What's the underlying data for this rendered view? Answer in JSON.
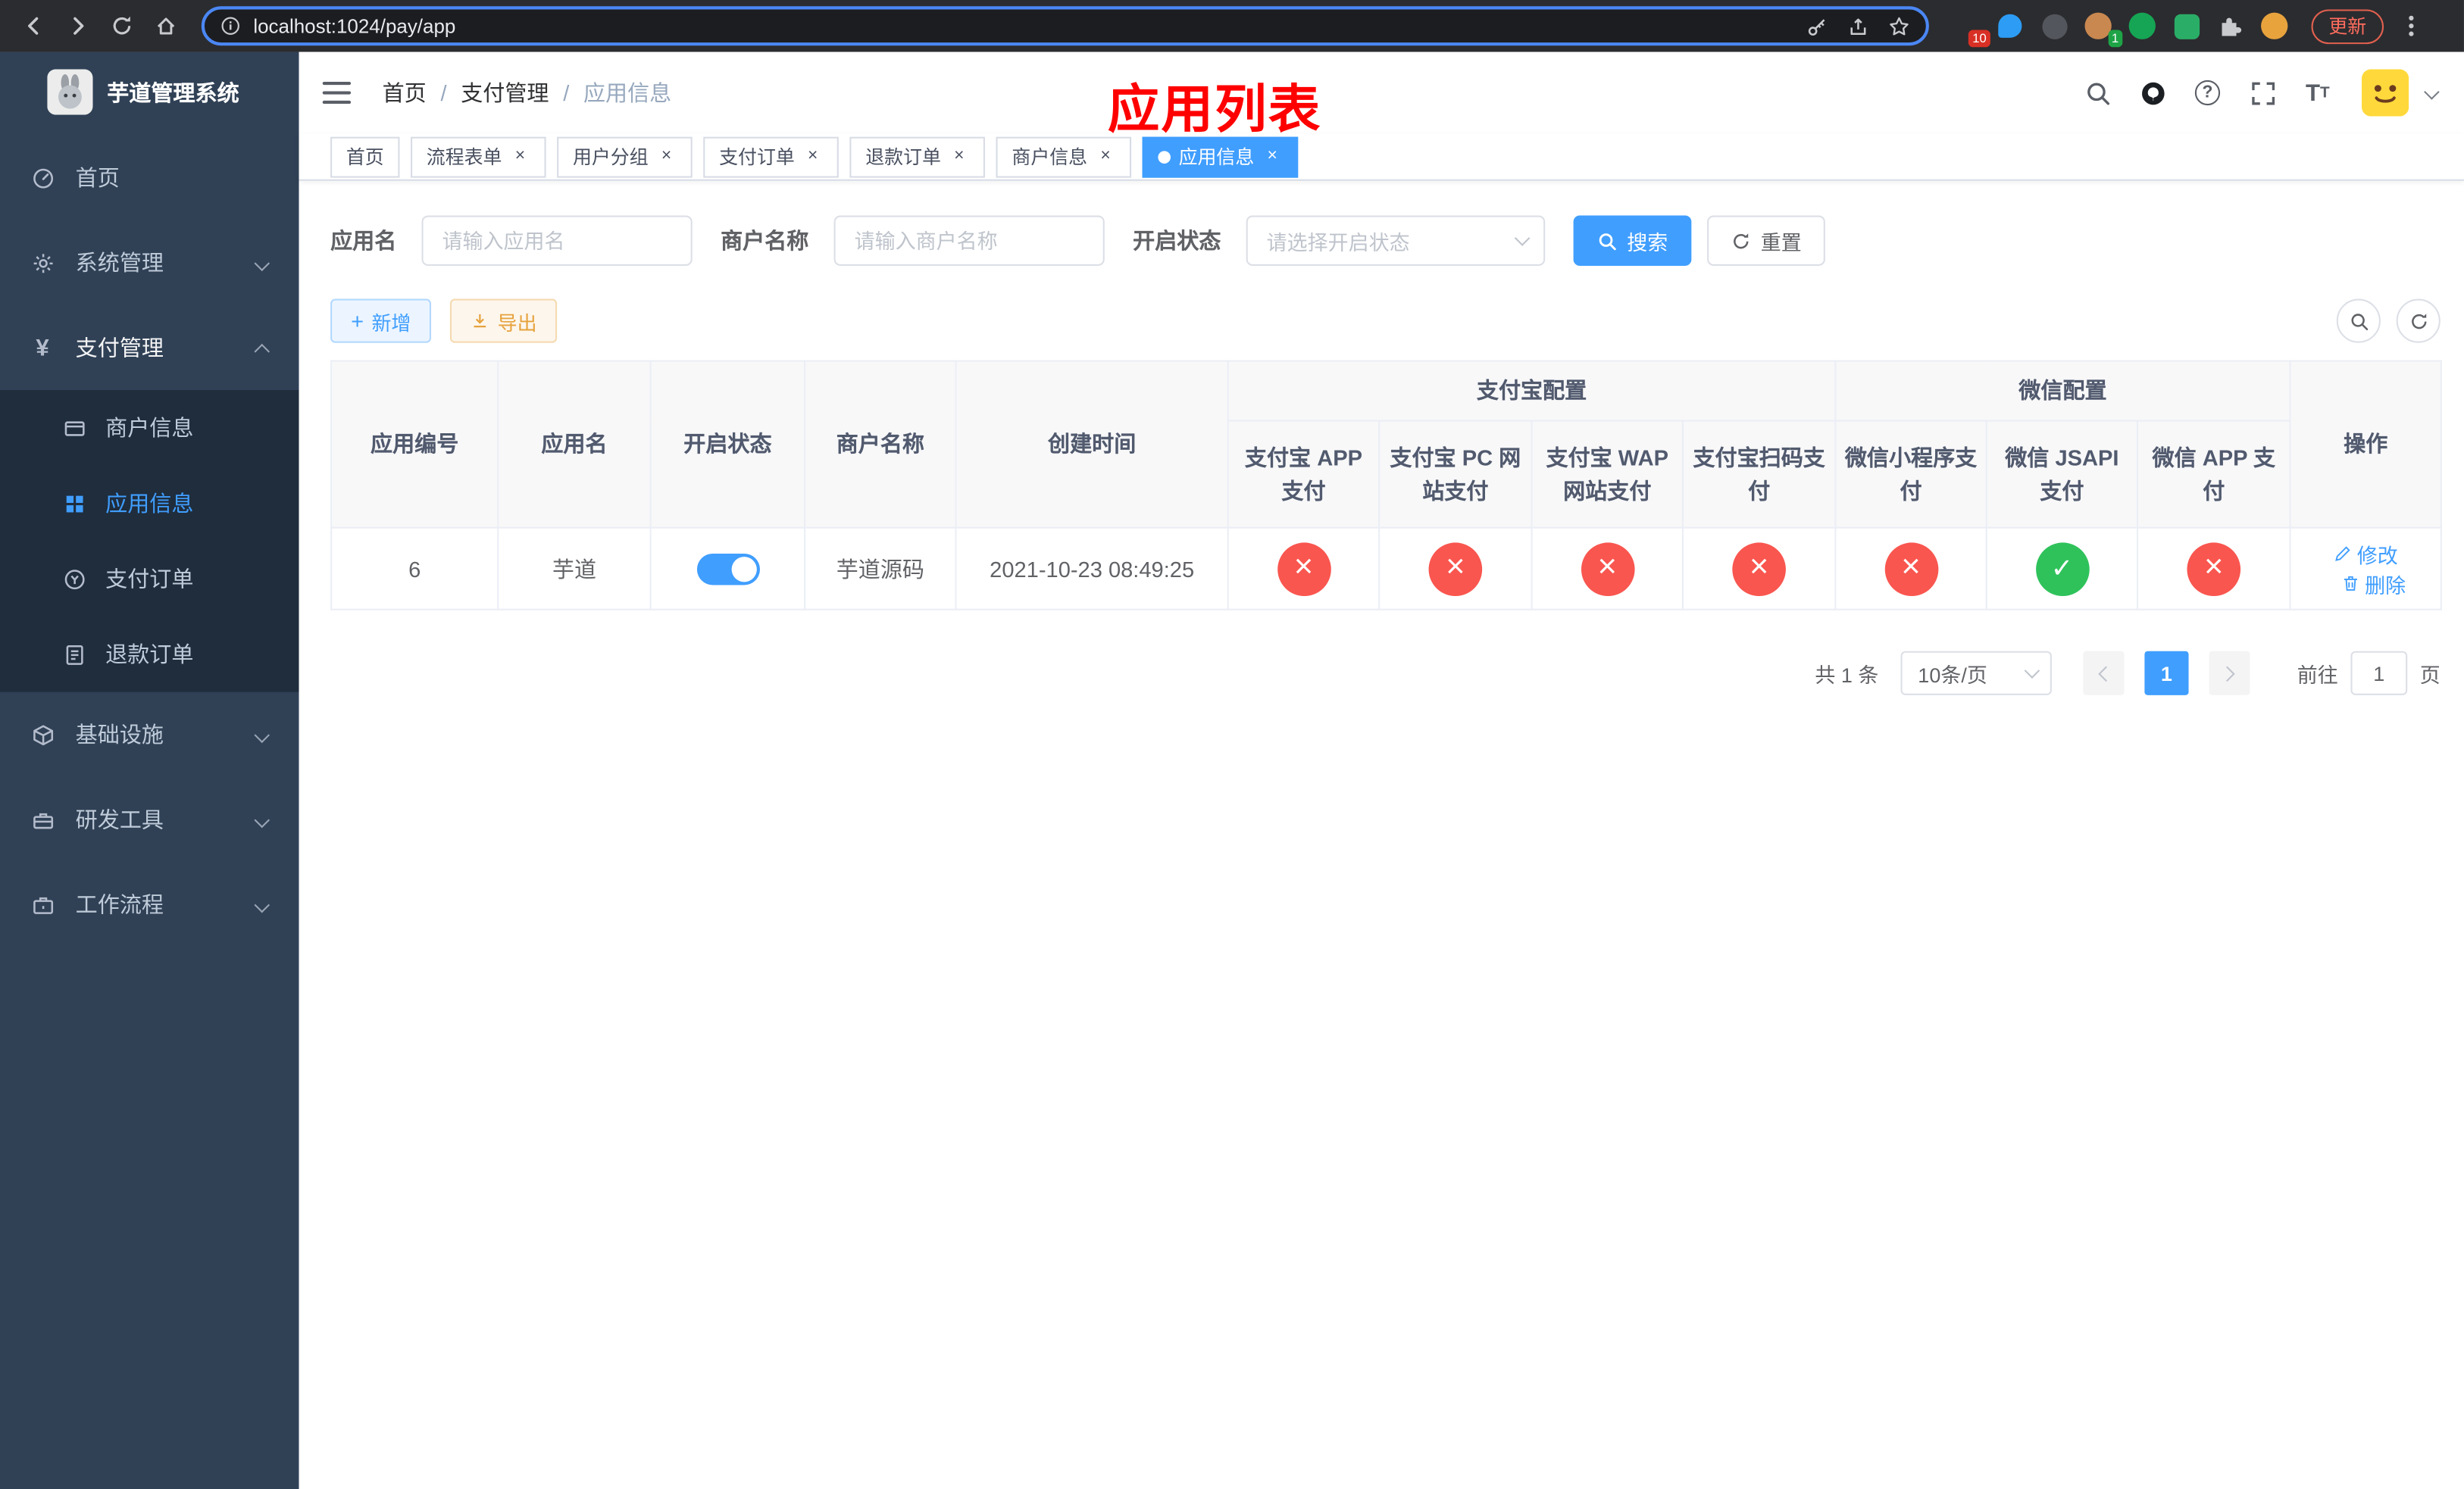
{
  "colors": {
    "primary": "#409eff",
    "danger": "#f9564f",
    "success": "#2fc25b",
    "warning": "#e6a23c",
    "annotation": "#ff0000",
    "sidebar_bg": "#304156",
    "submenu_bg": "#1f2d3d"
  },
  "browser": {
    "url": "localhost:1024/pay/app",
    "update_label": "更新",
    "extensions_badge": "10",
    "avatar_badge": "1"
  },
  "sidebar": {
    "app_title": "芋道管理系统",
    "items": [
      {
        "label": "首页"
      },
      {
        "label": "系统管理"
      },
      {
        "label": "支付管理"
      },
      {
        "label": "基础设施"
      },
      {
        "label": "研发工具"
      },
      {
        "label": "工作流程"
      }
    ],
    "payment_children": [
      {
        "label": "商户信息"
      },
      {
        "label": "应用信息"
      },
      {
        "label": "支付订单"
      },
      {
        "label": "退款订单"
      }
    ]
  },
  "navbar": {
    "breadcrumb": [
      "首页",
      "支付管理",
      "应用信息"
    ]
  },
  "annotation": "应用列表",
  "tabs": [
    {
      "label": "首页"
    },
    {
      "label": "流程表单"
    },
    {
      "label": "用户分组"
    },
    {
      "label": "支付订单"
    },
    {
      "label": "退款订单"
    },
    {
      "label": "商户信息"
    },
    {
      "label": "应用信息"
    }
  ],
  "filters": {
    "app_name_label": "应用名",
    "app_name_placeholder": "请输入应用名",
    "merchant_label": "商户名称",
    "merchant_placeholder": "请输入商户名称",
    "status_label": "开启状态",
    "status_placeholder": "请选择开启状态",
    "search_label": "搜索",
    "reset_label": "重置"
  },
  "toolbar": {
    "add_label": "新增",
    "export_label": "导出"
  },
  "table": {
    "group_alipay": "支付宝配置",
    "group_wechat": "微信配置",
    "columns": [
      "应用编号",
      "应用名",
      "开启状态",
      "商户名称",
      "创建时间",
      "支付宝 APP 支付",
      "支付宝 PC 网站支付",
      "支付宝 WAP 网站支付",
      "支付宝扫码支付",
      "微信小程序支付",
      "微信 JSAPI 支付",
      "微信 APP 支付",
      "操作"
    ],
    "rows": [
      {
        "id": "6",
        "name": "芋道",
        "enabled": "on",
        "merchant": "芋道源码",
        "created": "2021-10-23 08:49:25",
        "statuses": [
          "no",
          "no",
          "no",
          "no",
          "no",
          "yes",
          "no"
        ],
        "edit_label": "修改",
        "delete_label": "删除"
      }
    ]
  },
  "pagination": {
    "total": "共 1 条",
    "page_size": "10条/页",
    "page": "1",
    "goto_label": "前往",
    "goto_value": "1",
    "unit_label": "页"
  }
}
